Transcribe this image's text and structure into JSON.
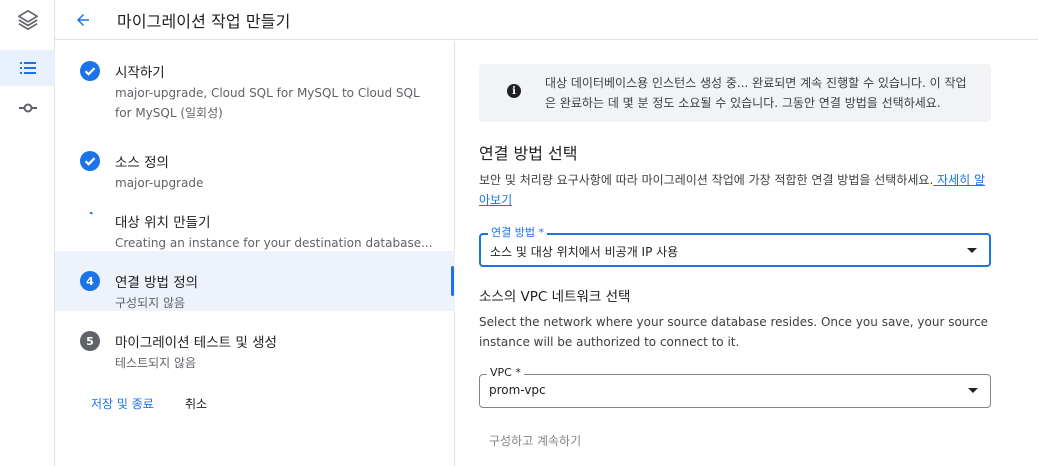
{
  "header": {
    "title": "마이그레이션 작업 만들기"
  },
  "rail": {
    "icons": [
      "layers-icon",
      "list-icon",
      "commit-icon"
    ]
  },
  "steps": [
    {
      "state": "done",
      "title": "시작하기",
      "subtitle": "major-upgrade, Cloud SQL for MySQL to Cloud SQL for MySQL (일회성)"
    },
    {
      "state": "done",
      "title": "소스 정의",
      "subtitle": "major-upgrade"
    },
    {
      "state": "in-progress",
      "title": "대상 위치 만들기",
      "subtitle": "Creating an instance for your destination database..."
    },
    {
      "state": "current",
      "number": "4",
      "title": "연결 방법 정의",
      "subtitle": "구성되지 않음"
    },
    {
      "state": "pending",
      "number": "5",
      "title": "마이그레이션 테스트 및 생성",
      "subtitle": "테스트되지 않음"
    }
  ],
  "actions": {
    "save_exit": "저장 및 종료",
    "cancel": "취소"
  },
  "info": {
    "text": "대상 데이터베이스용 인스턴스 생성 중... 완료되면 계속 진행할 수 있습니다. 이 작업은 완료하는 데 몇 분 정도 소요될 수 있습니다. 그동안 연결 방법을 선택하세요."
  },
  "connectivity": {
    "heading": "연결 방법 선택",
    "description": "보안 및 처리량 요구사항에 따라 마이그레이션 작업에 가장 적합한 연결 방법을 선택하세요.",
    "learn_more": " 자세히 알아보기",
    "method_label": "연결 방법 *",
    "method_value": "소스 및 대상 위치에서 비공개 IP 사용"
  },
  "vpc": {
    "heading": "소스의 VPC 네트워크 선택",
    "description": "Select the network where your source database resides. Once you save, your source instance will be authorized to connect to it.",
    "label": "VPC *",
    "value": "prom-vpc"
  },
  "continue_label": "구성하고 계속하기",
  "colors": {
    "primary": "#1a73e8",
    "done": "#1a73e8",
    "pending": "#5f6368",
    "current_bg": "#eef2fb"
  }
}
